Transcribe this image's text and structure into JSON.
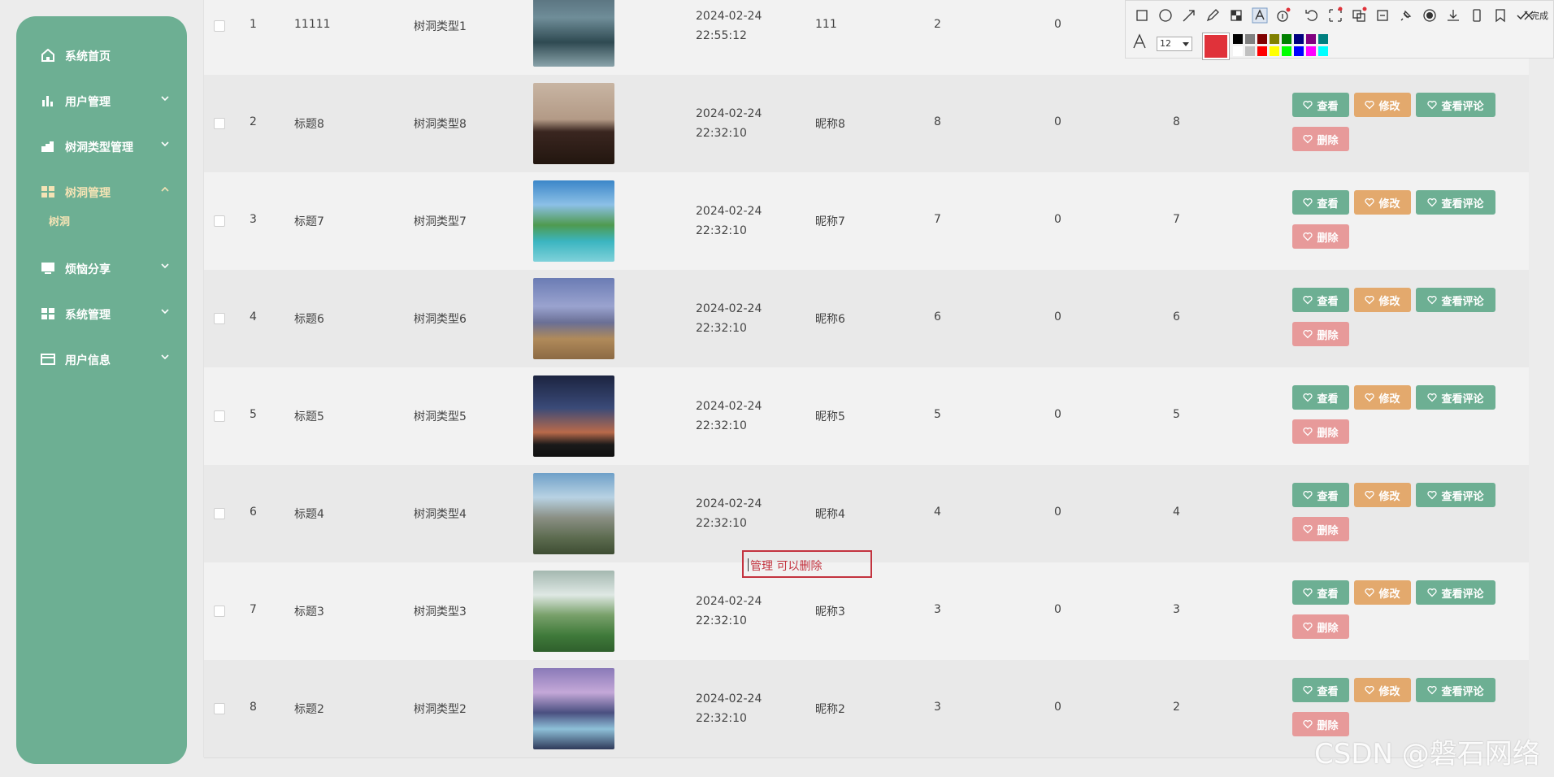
{
  "sidebar": {
    "items": [
      {
        "label": "系统首页",
        "icon": "home-icon"
      },
      {
        "label": "用户管理",
        "icon": "bar-chart-icon"
      },
      {
        "label": "树洞类型管理",
        "icon": "cloud-icon"
      },
      {
        "label": "树洞管理",
        "icon": "grid-icon"
      },
      {
        "label": "烦恼分享",
        "icon": "monitor-icon"
      },
      {
        "label": "系统管理",
        "icon": "grid-icon"
      },
      {
        "label": "用户信息",
        "icon": "id-card-icon"
      }
    ],
    "sub_item": "树洞",
    "active_label_color": "#f4e3b5"
  },
  "table": {
    "rows": [
      {
        "index": "1",
        "title": "11111",
        "type": "树洞类型1",
        "time": "2024-02-24 22:55:12",
        "nickname": "111",
        "c1": "2",
        "c2": "0",
        "c3": ""
      },
      {
        "index": "2",
        "title": "标题8",
        "type": "树洞类型8",
        "time": "2024-02-24 22:32:10",
        "nickname": "昵称8",
        "c1": "8",
        "c2": "0",
        "c3": "8"
      },
      {
        "index": "3",
        "title": "标题7",
        "type": "树洞类型7",
        "time": "2024-02-24 22:32:10",
        "nickname": "昵称7",
        "c1": "7",
        "c2": "0",
        "c3": "7"
      },
      {
        "index": "4",
        "title": "标题6",
        "type": "树洞类型6",
        "time": "2024-02-24 22:32:10",
        "nickname": "昵称6",
        "c1": "6",
        "c2": "0",
        "c3": "6"
      },
      {
        "index": "5",
        "title": "标题5",
        "type": "树洞类型5",
        "time": "2024-02-24 22:32:10",
        "nickname": "昵称5",
        "c1": "5",
        "c2": "0",
        "c3": "5"
      },
      {
        "index": "6",
        "title": "标题4",
        "type": "树洞类型4",
        "time": "2024-02-24 22:32:10",
        "nickname": "昵称4",
        "c1": "4",
        "c2": "0",
        "c3": "4"
      },
      {
        "index": "7",
        "title": "标题3",
        "type": "树洞类型3",
        "time": "2024-02-24 22:32:10",
        "nickname": "昵称3",
        "c1": "3",
        "c2": "0",
        "c3": "3"
      },
      {
        "index": "8",
        "title": "标题2",
        "type": "树洞类型2",
        "time": "2024-02-24 22:32:10",
        "nickname": "昵称2",
        "c1": "3",
        "c2": "0",
        "c3": "2"
      }
    ],
    "actions": {
      "view": "查看",
      "edit": "修改",
      "comments": "查看评论",
      "delete": "删除"
    }
  },
  "annotation": {
    "text": "管理 可以删除"
  },
  "screenshot_toolbar": {
    "font_size": "12",
    "done_label": "完成",
    "current_color": "#e0323a",
    "swatches": [
      "#000000",
      "#808080",
      "#800000",
      "#808000",
      "#008000",
      "#000080",
      "#800080",
      "#008080",
      "#ffffff",
      "#c0c0c0",
      "#ff0000",
      "#ffff00",
      "#00ff00",
      "#0000ff",
      "#ff00ff",
      "#00ffff"
    ]
  },
  "watermark": "CSDN @磐石网络"
}
